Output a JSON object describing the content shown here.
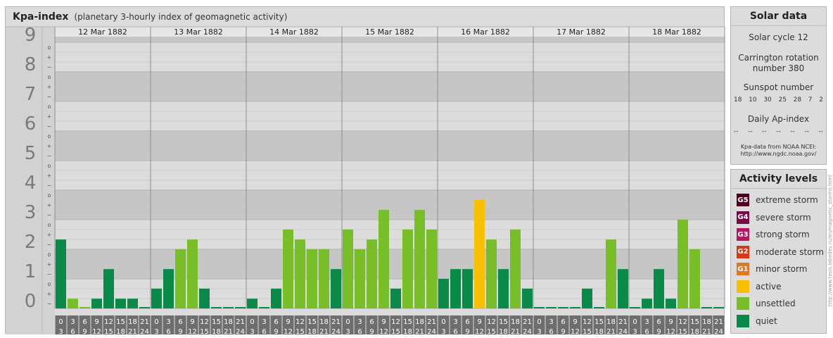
{
  "chart_data": {
    "type": "bar",
    "title": "Kpa-index",
    "subtitle": "(planetary 3-hourly index of geomagnetic activity)",
    "ylim": [
      0,
      9
    ],
    "y_ticks": [
      "0",
      "1",
      "2",
      "3",
      "4",
      "5",
      "6",
      "7",
      "8",
      "9"
    ],
    "sub_tick_marks": [
      "−",
      "+",
      "o"
    ],
    "days": [
      "12 Mar 1882",
      "13 Mar 1882",
      "14 Mar 1882",
      "15 Mar 1882",
      "16 Mar 1882",
      "17 Mar 1882",
      "18 Mar 1882"
    ],
    "interval_start_labels": [
      "0",
      "3",
      "6",
      "9",
      "12",
      "15",
      "18",
      "21"
    ],
    "interval_end_labels": [
      "3",
      "6",
      "9",
      "12",
      "15",
      "18",
      "21",
      "24"
    ],
    "values": [
      2.33,
      0.33,
      0,
      0.33,
      1.33,
      0.33,
      0.33,
      0,
      0.67,
      1.33,
      2,
      2.33,
      0.67,
      0,
      0,
      0,
      0.33,
      0,
      0.67,
      2.67,
      2.33,
      2,
      2,
      1.33,
      2.67,
      2,
      2.33,
      3.33,
      0.67,
      2.67,
      3.33,
      2.67,
      1,
      1.33,
      1.33,
      3.67,
      2.33,
      1.33,
      2.67,
      0.67,
      0,
      0,
      0,
      0,
      0.67,
      0,
      2.33,
      1.33,
      0,
      0.33,
      1.33,
      0.33,
      3,
      2,
      0,
      0
    ],
    "levels": [
      "quiet",
      "unsettled",
      "unsettled",
      "quiet",
      "quiet",
      "quiet",
      "quiet",
      "quiet",
      "quiet",
      "quiet",
      "unsettled",
      "unsettled",
      "quiet",
      "quiet",
      "quiet",
      "quiet",
      "quiet",
      "quiet",
      "quiet",
      "unsettled",
      "unsettled",
      "unsettled",
      "unsettled",
      "quiet",
      "unsettled",
      "unsettled",
      "unsettled",
      "unsettled",
      "quiet",
      "unsettled",
      "unsettled",
      "unsettled",
      "quiet",
      "quiet",
      "quiet",
      "active",
      "unsettled",
      "quiet",
      "unsettled",
      "quiet",
      "quiet",
      "quiet",
      "quiet",
      "quiet",
      "quiet",
      "quiet",
      "unsettled",
      "quiet",
      "quiet",
      "quiet",
      "quiet",
      "quiet",
      "unsettled",
      "unsettled",
      "quiet",
      "quiet"
    ],
    "grid": true
  },
  "colors": {
    "quiet": "#0a8a48",
    "unsettled": "#78be28",
    "active": "#f8c000",
    "minor_storm": "#e07820",
    "moderate_storm": "#d83818",
    "strong_storm": "#b01860",
    "severe_storm": "#780c48",
    "extreme_storm": "#500020"
  },
  "solar_data": {
    "title": "Solar data",
    "solar_cycle": "Solar cycle 12",
    "carrington_line1": "Carrington rotation",
    "carrington_line2": "number 380",
    "sunspot_title": "Sunspot number",
    "sunspot_values": [
      "18",
      "10",
      "30",
      "25",
      "28",
      "7",
      "2"
    ],
    "ap_title": "Daily Ap-index",
    "ap_values": [
      "--",
      "--",
      "--",
      "--",
      "--",
      "--",
      "--"
    ],
    "credit_line1": "Kpa-data from NOAA NCEI:",
    "credit_line2": "http://www.ngdc.noaa.gov/"
  },
  "activity_levels": {
    "title": "Activity levels",
    "items": [
      {
        "code": "G5",
        "label": "extreme storm",
        "color_key": "extreme_storm"
      },
      {
        "code": "G4",
        "label": "severe storm",
        "color_key": "severe_storm"
      },
      {
        "code": "G3",
        "label": "strong storm",
        "color_key": "strong_storm"
      },
      {
        "code": "G2",
        "label": "moderate storm",
        "color_key": "moderate_storm"
      },
      {
        "code": "G1",
        "label": "minor storm",
        "color_key": "minor_storm"
      },
      {
        "code": "",
        "label": "active",
        "color_key": "active"
      },
      {
        "code": "",
        "label": "unsettled",
        "color_key": "unsettled"
      },
      {
        "code": "",
        "label": "quiet",
        "color_key": "quiet"
      }
    ]
  },
  "watermark": "http://www.tesis.lebedev.ru/en/magnetic_storms.html"
}
